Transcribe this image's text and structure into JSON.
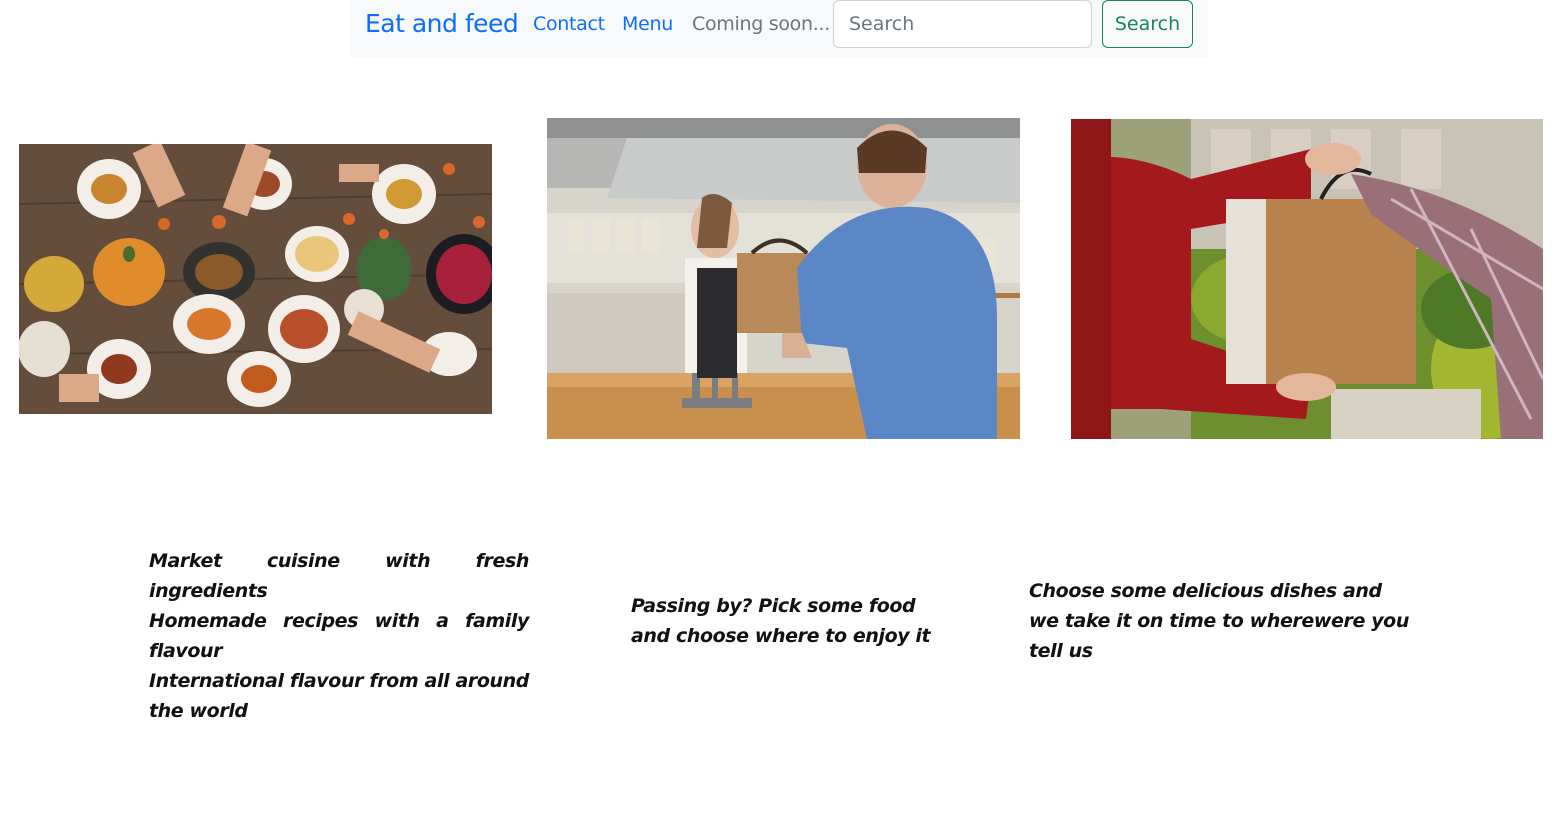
{
  "navbar": {
    "brand": "Eat and feed",
    "links": [
      {
        "label": "Contact"
      },
      {
        "label": "Menu"
      },
      {
        "label": "Coming soon..."
      }
    ],
    "search": {
      "placeholder": "Search",
      "value": "",
      "button_label": "Search"
    }
  },
  "gallery": {
    "images": [
      {
        "icon": "food-table-photo"
      },
      {
        "icon": "counter-takeaway-photo"
      },
      {
        "icon": "bag-delivery-photo"
      }
    ]
  },
  "captions": [
    {
      "lines": [
        "Market cuisine with fresh ingredients",
        "Homemade recipes with a family flavour",
        "International flavour from all around the world"
      ]
    },
    {
      "lines": [
        "Passing by? Pick some food and choose where to enjoy it"
      ]
    },
    {
      "lines": [
        "Choose some delicious dishes and",
        "we take it on time to wherewere you tell us"
      ]
    }
  ],
  "colors": {
    "link": "#0d6efd",
    "muted": "#6c757d",
    "success": "#198754",
    "navbar_bg": "#f8f9fa"
  }
}
